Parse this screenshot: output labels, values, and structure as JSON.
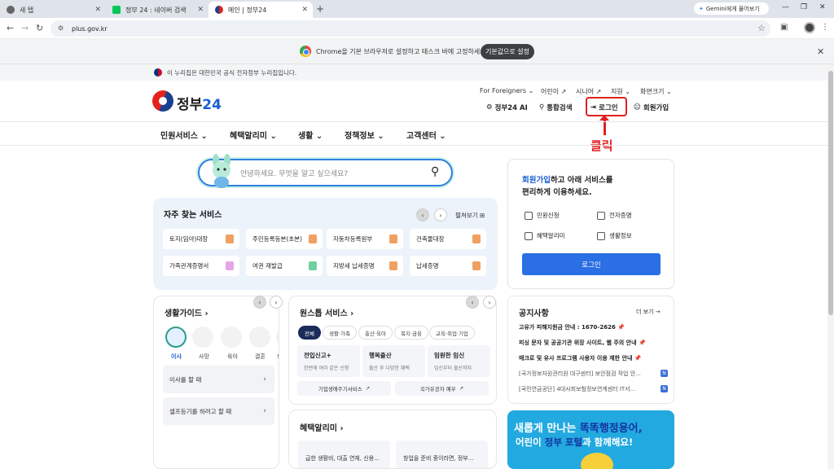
{
  "browser": {
    "tabs": [
      {
        "label": "새 탭"
      },
      {
        "label": "정부 24 : 네이버 검색"
      },
      {
        "label": "메인 | 정부24"
      }
    ],
    "gemini_label": "Gemini에게 물어보기",
    "url": "plus.gov.kr",
    "infobar_text": "Chrome을 기본 브라우저로 설정하고 태스크 바에 고정하세요.",
    "infobar_button": "기본값으로 설정"
  },
  "site": {
    "gov_notice": "이 누리집은 대한민국 공식 전자정부 누리집입니다.",
    "logo_text": "정부",
    "logo_num": "24",
    "util_top": [
      "For Foreigners",
      "어린이",
      "시니어",
      "지원",
      "화면크기"
    ],
    "util_main": {
      "ai": "정부24 AI",
      "search": "통합검색",
      "login": "로그인",
      "signup": "회원가입"
    },
    "annotation": "클릭",
    "gnb": [
      "민원서비스",
      "혜택알리미",
      "생활",
      "정책정보",
      "고객센터"
    ],
    "search_placeholder": "안녕하세요. 무엇을 알고 싶으세요?",
    "quick": {
      "title": "자주 찾는 서비스",
      "all_view": "펼쳐보기",
      "items": [
        "토지(임야)대장",
        "주민등록등본(초본)",
        "자동차등록원부",
        "건축물대장",
        "가족관계증명서",
        "여권 재발급",
        "지방세 납세증명",
        "납세증명"
      ]
    },
    "loginbox": {
      "link": "회원가입",
      "text1": "하고 아래 서비스를",
      "text2": "편리하게 이용하세요.",
      "items": [
        "민원신청",
        "전자증명",
        "혜택알리미",
        "생활정보"
      ],
      "button": "로그인"
    },
    "lifeguide": {
      "title": "생활가이드",
      "icons": [
        "이사",
        "사망",
        "육아",
        "결혼",
        "보"
      ],
      "rows": [
        "이사를 할 때",
        "셀프등기를 하려고 할 때"
      ]
    },
    "onestop": {
      "title": "원스톱 서비스",
      "chips": [
        "전체",
        "생활·가족",
        "출산·육아",
        "복지·금융",
        "교육·취업·기업"
      ],
      "cards": [
        {
          "title": "전입신고+",
          "sub": "한번에 여러 같은 신청"
        },
        {
          "title": "행복출산",
          "sub": "출산 후 다양한 혜택"
        },
        {
          "title": "임원한 임신",
          "sub": "임신부터 출산까지"
        }
      ],
      "links": [
        "기업생애주기서비스",
        "국가유공자 예우"
      ]
    },
    "benefit": {
      "title": "혜택알리미",
      "cards": [
        "급한 생활비, 대출 연체, 신용...",
        "창업을 준비 중이라면, 정부..."
      ]
    },
    "notice": {
      "title": "공지사항",
      "more": "더 보기 →",
      "items": [
        "고유가 피해지원금 안내 : 1670-2626",
        "피싱 문자 및 공공기관 위장 사이트, 웹 주의 안내",
        "매크로 및 유사 프로그램 사용자 이용 제한 안내",
        "[국가정보자원관리원 대구센터] 보안점검 작업 안...",
        "[국민연금공단] 4대사회보험정보연계센터 IT서..."
      ],
      "badge": "N"
    },
    "banner": {
      "line1a": "새롭게 만나는 ",
      "line1b": "똑똑행정용어,",
      "line2a": "어린이 ",
      "line2b": "정부 포털",
      "line2c": "과 함께해요!"
    }
  },
  "colors": {
    "accent": "#1a5fd0",
    "login_button": "#2b6fe5",
    "annotation": "#e02020",
    "banner_bg": "#22a9e0"
  }
}
